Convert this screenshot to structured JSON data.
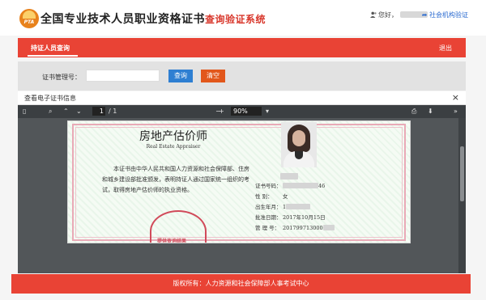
{
  "header": {
    "logo_text": "PTA",
    "title_main": "全国专业技术人员职业资格证书",
    "title_sub": "查询验证系统",
    "greeting": "您好，",
    "org_link": "社会机构验证"
  },
  "nav": {
    "active_tab": "持证人员查询",
    "logout": "退出"
  },
  "search": {
    "label": "证书管理号：",
    "input_value": "",
    "query_button": "查询",
    "clear_button": "清空"
  },
  "modal": {
    "title": "查看电子证书信息",
    "close": "×"
  },
  "pdf_toolbar": {
    "page_current": "1",
    "page_total": "/ 1",
    "zoom_minus": "−",
    "zoom_plus": "+",
    "zoom": "90%"
  },
  "certificate": {
    "title": "房地产估价师",
    "subtitle": "Real Estate Appraiser",
    "body": "本证书由中华人民共和国人力资源和社会保障部、住房和城乡建设部批准颁发，表明持证人通过国家统一组织的考试，取得房地产估价师的执业资格。",
    "stamp_text": "提供查询结果",
    "fields": [
      {
        "label": "",
        "value": ""
      },
      {
        "label": "证书号码：",
        "value": "46"
      },
      {
        "label": "性    别：",
        "value": "女"
      },
      {
        "label": "出生年月：",
        "value": "1"
      },
      {
        "label": "批准日期：",
        "value": "2017年10月15日"
      },
      {
        "label": "管 理 号：",
        "value": "201799713000"
      }
    ]
  },
  "footer": {
    "text": "版权所有：人力资源和社会保障部人事考试中心"
  },
  "colors": {
    "brand_red": "#e94335",
    "query_blue": "#2e7fd2",
    "clear_orange": "#e2571b"
  }
}
